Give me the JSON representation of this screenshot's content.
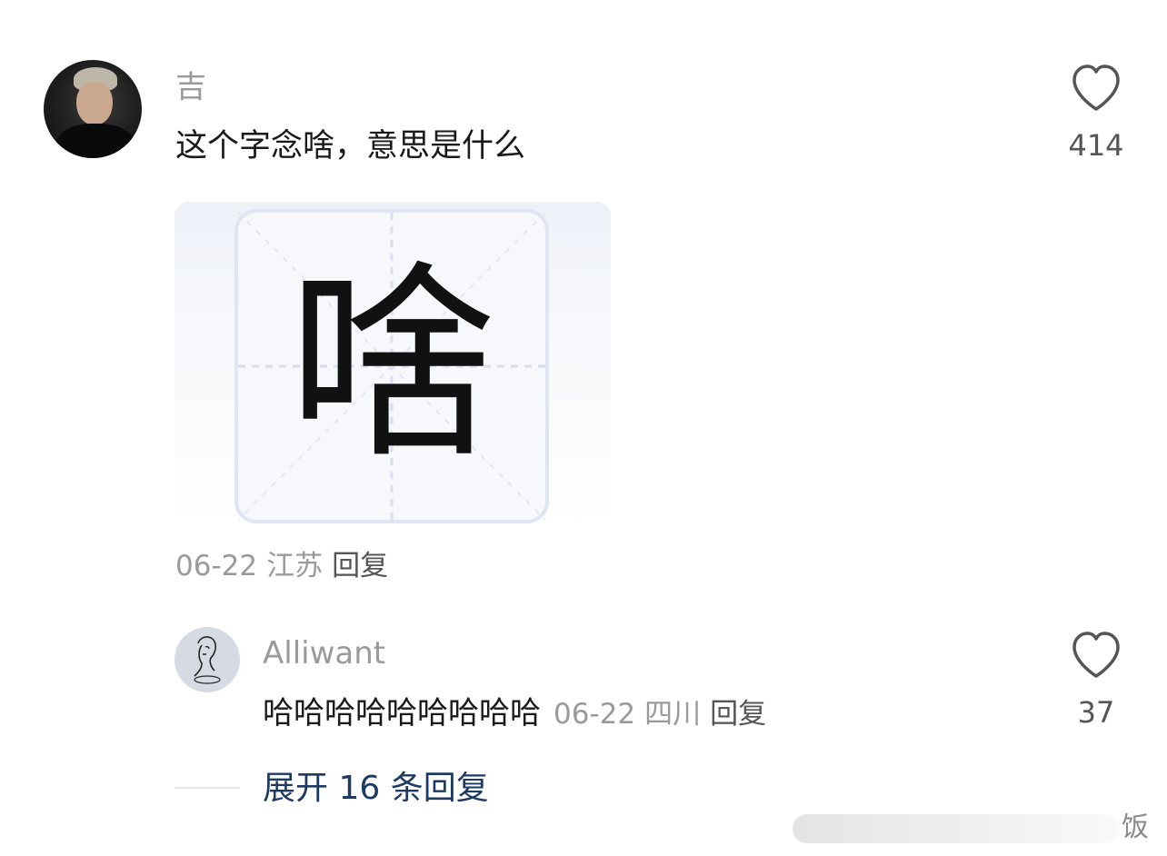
{
  "main_comment": {
    "username": "吉",
    "text": "这个字念啥，意思是什么",
    "likes": "414",
    "image_character": "啥",
    "date": "06-22",
    "location": "江苏",
    "reply_label": "回复"
  },
  "reply_comment": {
    "username": "Alliwant",
    "text": "哈哈哈哈哈哈哈哈哈",
    "likes": "37",
    "date": "06-22",
    "location": "四川",
    "reply_label": "回复"
  },
  "expand_replies_label": "展开 16 条回复",
  "watermark": "饭",
  "icons": {
    "like": "heart-outline-icon"
  },
  "colors": {
    "username": "#9a9a9a",
    "text": "#1a1a1a",
    "expand_link": "#1d3a63"
  }
}
